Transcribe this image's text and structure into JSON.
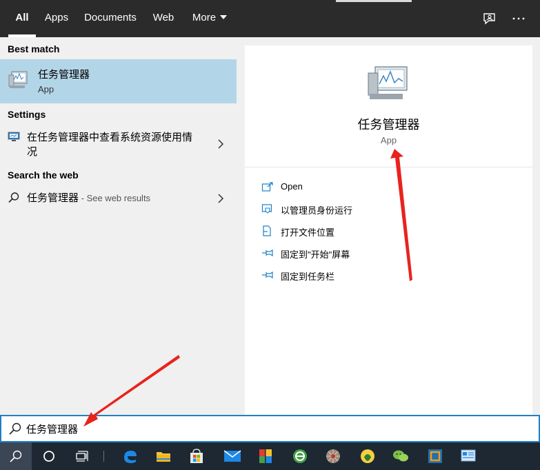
{
  "tabs": [
    {
      "label": "All",
      "active": true
    },
    {
      "label": "Apps"
    },
    {
      "label": "Documents"
    },
    {
      "label": "Web"
    },
    {
      "label": "More"
    }
  ],
  "top_icons": [
    "feedback-icon",
    "more-options-icon"
  ],
  "best_match": {
    "section_label": "Best match",
    "name": "任务管理器",
    "type": "App"
  },
  "settings": {
    "section_label": "Settings",
    "item_line1": "在任务管理器中查看系统资源使用情",
    "item_line2": "况"
  },
  "web": {
    "section_label": "Search the web",
    "query": "任务管理器",
    "hint": " - See web results"
  },
  "preview": {
    "name": "任务管理器",
    "type": "App",
    "actions": [
      {
        "label": "Open",
        "icon": "open-icon"
      },
      {
        "label": "以管理员身份运行",
        "icon": "run-as-admin-icon"
      },
      {
        "label": "打开文件位置",
        "icon": "file-location-icon"
      },
      {
        "label": "固定到\"开始\"屏幕",
        "icon": "pin-icon"
      },
      {
        "label": "固定到任务栏",
        "icon": "pin-icon"
      }
    ]
  },
  "search": {
    "value": "任务管理器"
  },
  "taskbar": [
    "search-icon",
    "cortana-icon",
    "task-view-icon",
    "edge-icon",
    "file-explorer-icon",
    "store-icon",
    "mail-icon",
    "app-icon",
    "browser-icon",
    "globe-app-icon",
    "qq-icon",
    "wechat-icon",
    "virtualbox-icon",
    "control-panel-icon"
  ],
  "colors": {
    "accent": "#1f7fc8",
    "selection": "#b3d5e8",
    "topbar": "#2b2b2b",
    "taskbar": "#1d2833"
  }
}
